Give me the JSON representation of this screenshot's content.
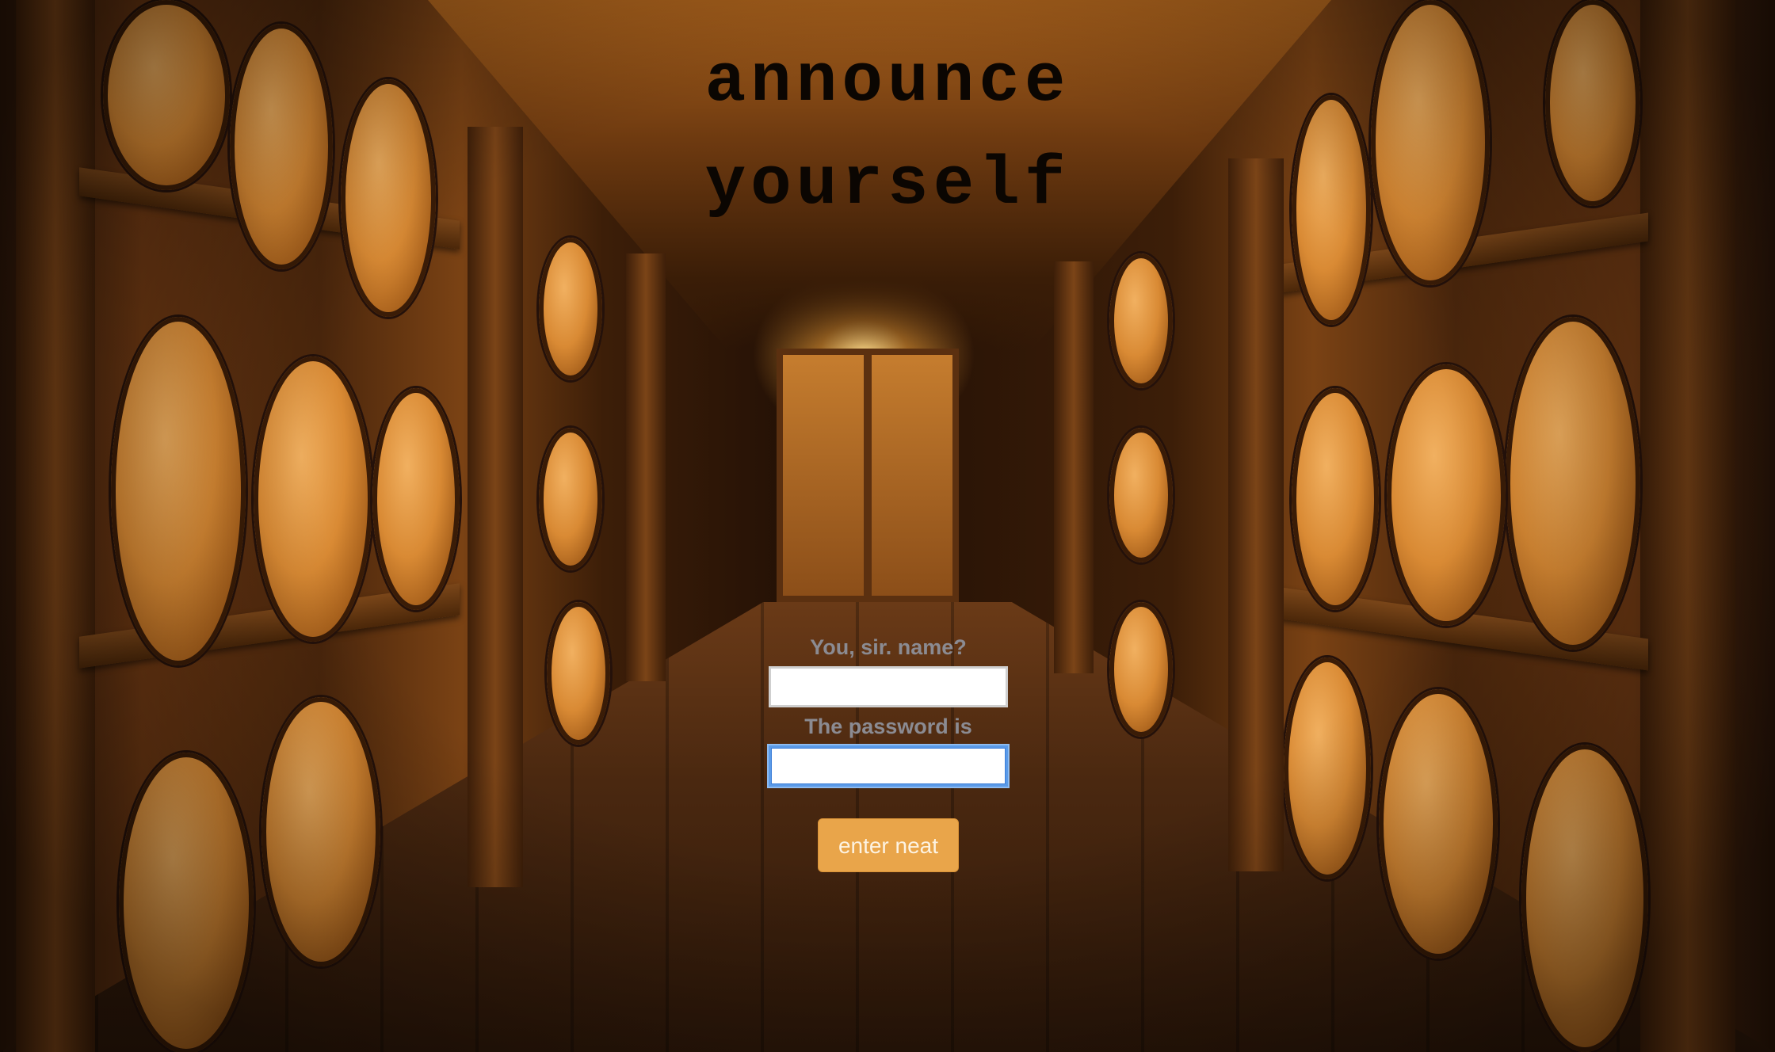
{
  "title": {
    "line1": "announce",
    "line2": "yourself"
  },
  "login_form": {
    "username_label": "You, sir. name?",
    "username_value": "",
    "password_label": "The password is",
    "password_value": "",
    "submit_label": "enter neat"
  },
  "colors": {
    "button_bg": "#e9a54a",
    "label_text": "#8b8b92",
    "focus_ring": "#5a9ae8",
    "title_text": "#0b0602"
  }
}
